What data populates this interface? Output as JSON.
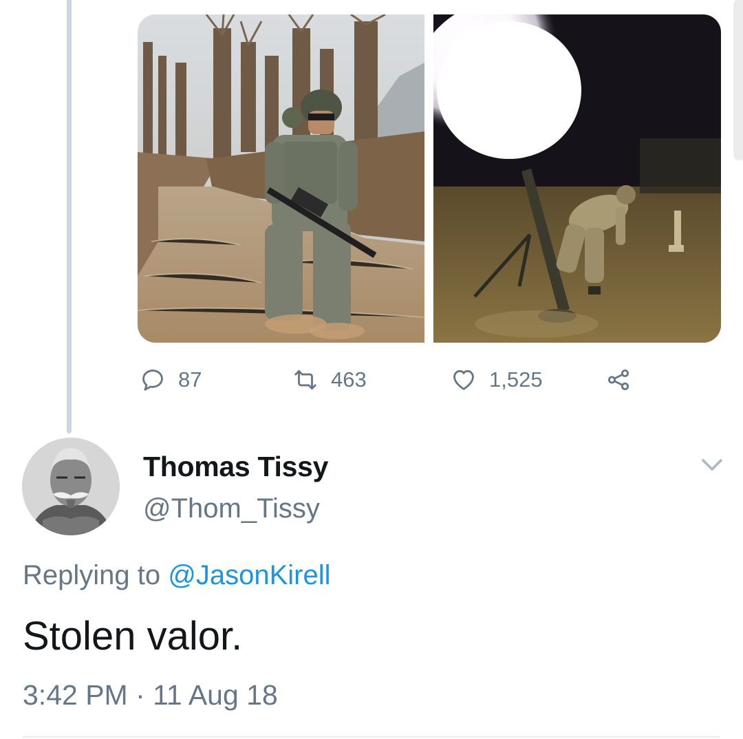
{
  "tweet_above": {
    "actions": {
      "reply_count": "87",
      "retweet_count": "463",
      "like_count": "1,525"
    },
    "media": [
      {
        "icon": "photo-soldier-wading-stream"
      },
      {
        "icon": "photo-mortar-firing-night"
      }
    ]
  },
  "reply_tweet": {
    "display_name": "Thomas Tissy",
    "handle": "@Thom_Tissy",
    "replying_prefix": "Replying to ",
    "replying_to": "@JasonKirell",
    "text": "Stolen valor.",
    "timestamp": "3:42 PM · 11 Aug 18"
  },
  "colors": {
    "primary_text": "#14171a",
    "secondary_text": "#657786",
    "link": "#1b95e0",
    "thread_line": "#ccd6dd",
    "divider": "#e6ecf0"
  }
}
